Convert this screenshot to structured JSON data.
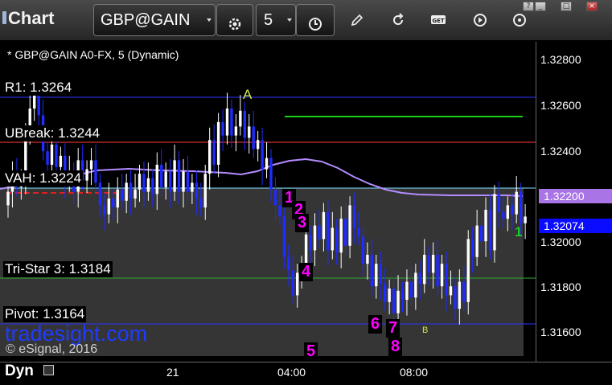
{
  "app": {
    "title": "Chart"
  },
  "toolbar": {
    "symbol": "GBP@GAIN",
    "interval": "5",
    "icons": [
      "settings-icon",
      "clock-icon",
      "pencil-icon",
      "refresh-icon",
      "get-icon",
      "play-icon",
      "options-icon"
    ]
  },
  "window_buttons": [
    "?",
    "_",
    "□",
    "×"
  ],
  "chart_title": "* GBP@GAIN A0-FX, 5 (Dynamic)",
  "level_labels": {
    "r1": "R1: 1.3264",
    "ubreak": "UBreak: 1.3244",
    "vah": "VAH: 1.3224",
    "tristar": "Tri-Star 3: 1.3184",
    "pivot": "Pivot: 1.3164"
  },
  "price_axis": {
    "ticks": [
      "1.32800",
      "1.32600",
      "1.32400",
      "1.32000",
      "1.31800",
      "1.31600"
    ],
    "highlight_vah": "1.32200",
    "last_price": "1.32074"
  },
  "time_axis": {
    "ticks": [
      "21",
      "04:00",
      "08:00"
    ]
  },
  "footer": {
    "mode": "Dyn",
    "watermark": "tradesight.com",
    "copyright": "© eSignal, 2016"
  },
  "annotations": {
    "a": "A",
    "b": "B",
    "n1": "1",
    "n2": "2",
    "n3": "3",
    "n4": "4",
    "n5": "5",
    "n6": "6",
    "n7": "7",
    "n8": "8",
    "g1": "1"
  },
  "colors": {
    "up_candle": "#ffffff",
    "down_candle": "#1f2bff",
    "r1": "#2b34ff",
    "ubreak": "#ff3a3a",
    "vah": "#7fe0ff",
    "tristar": "#2faa2f",
    "pivot": "#2b34ff",
    "ma": "#b48cff",
    "annotation": "#ff00ff",
    "letter": "#d4e44f",
    "last_price_bg": "#0a0cff",
    "vah_price_bg": "#a874e6"
  },
  "chart_data": {
    "type": "candlestick",
    "symbol": "GBP@GAIN A0-FX",
    "interval": "5",
    "ylim": [
      1.3149,
      1.3286
    ],
    "levels": [
      {
        "name": "R1",
        "value": 1.3264
      },
      {
        "name": "UBreak",
        "value": 1.3244
      },
      {
        "name": "VAH",
        "value": 1.3224
      },
      {
        "name": "Tri-Star 3",
        "value": 1.3184
      },
      {
        "name": "Pivot",
        "value": 1.3164
      }
    ],
    "last_price": 1.32074,
    "close": [
      1.3222,
      1.323,
      1.3224,
      1.3228,
      1.3247,
      1.3259,
      1.3265,
      1.3256,
      1.324,
      1.3234,
      1.3243,
      1.3233,
      1.3238,
      1.3226,
      1.3231,
      1.3222,
      1.3236,
      1.3227,
      1.3232,
      1.3236,
      1.3226,
      1.3216,
      1.3212,
      1.3219,
      1.3215,
      1.3223,
      1.3218,
      1.3226,
      1.3219,
      1.3223,
      1.323,
      1.3222,
      1.3228,
      1.3221,
      1.3234,
      1.3224,
      1.3231,
      1.3222,
      1.3236,
      1.3222,
      1.3231,
      1.3222,
      1.3226,
      1.3219,
      1.3215,
      1.323,
      1.3245,
      1.3234,
      1.3253,
      1.3247,
      1.3259,
      1.3247,
      1.3251,
      1.3258,
      1.3246,
      1.3251,
      1.3241,
      1.3245,
      1.3232,
      1.3237,
      1.3223,
      1.3216,
      1.3211,
      1.3193,
      1.3187,
      1.3176,
      1.3186,
      1.3188,
      1.3203,
      1.3196,
      1.3207,
      1.3201,
      1.3213,
      1.3196,
      1.3206,
      1.3195,
      1.321,
      1.3198,
      1.3216,
      1.3206,
      1.3202,
      1.319,
      1.3194,
      1.318,
      1.319,
      1.3181,
      1.3173,
      1.3179,
      1.3168,
      1.3178,
      1.3174,
      1.3182,
      1.3175,
      1.3186,
      1.3181,
      1.3194,
      1.3186,
      1.3194,
      1.318,
      1.319,
      1.3176,
      1.318,
      1.317,
      1.3182,
      1.3173,
      1.3201,
      1.3193,
      1.3207,
      1.32,
      1.3214,
      1.3196,
      1.3221,
      1.3213,
      1.321,
      1.3216,
      1.3212,
      1.3222,
      1.3208,
      1.3211
    ]
  }
}
